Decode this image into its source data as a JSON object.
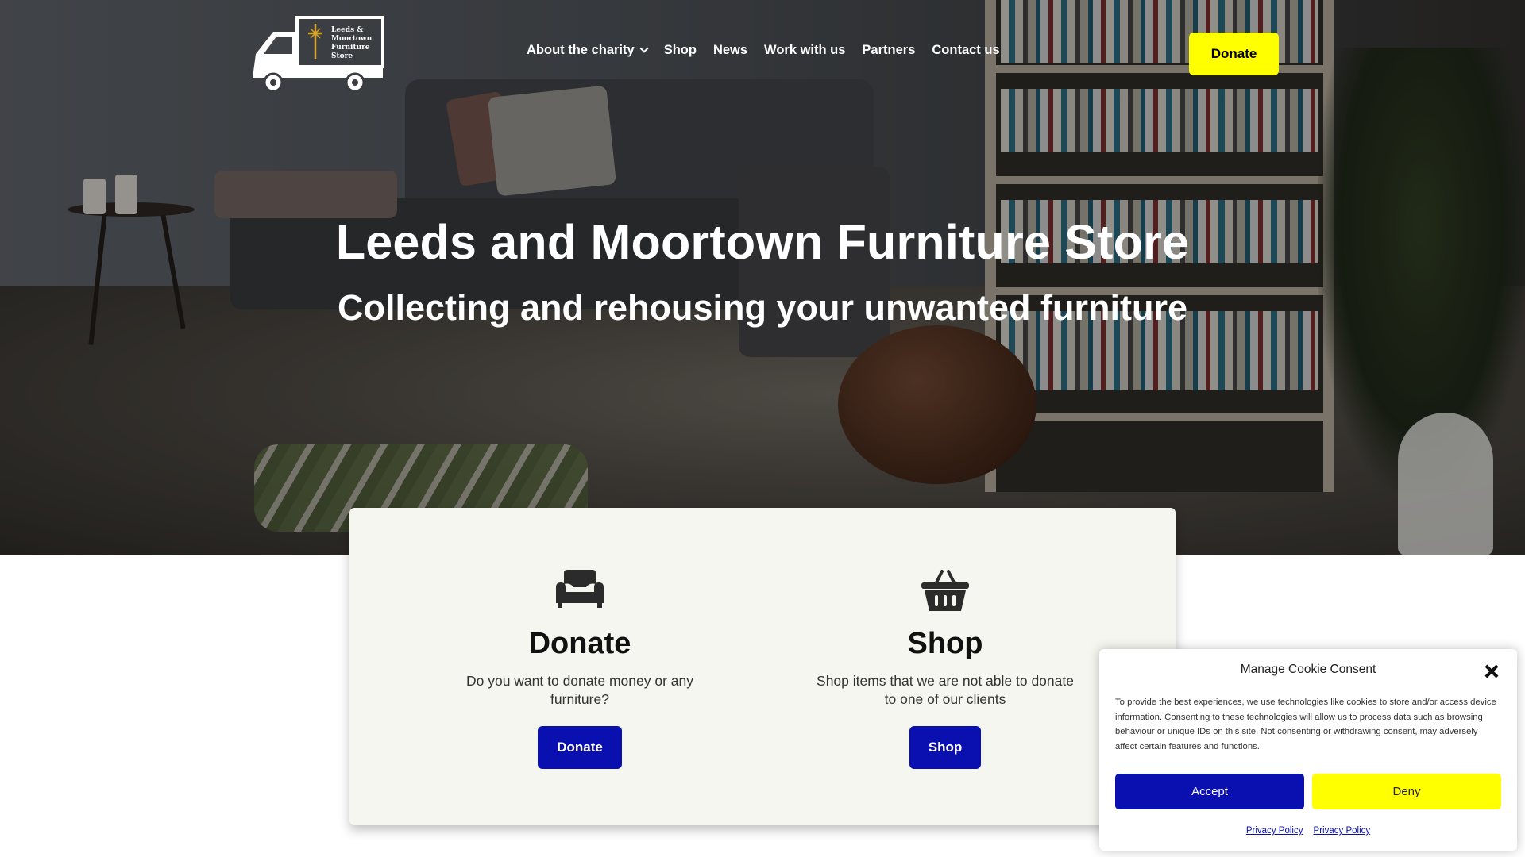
{
  "brand": {
    "logo_lines": [
      "Leeds &",
      "Moortown",
      "Furniture",
      "Store"
    ]
  },
  "nav": {
    "items": [
      {
        "label": "About the charity",
        "has_dropdown": true
      },
      {
        "label": "Shop"
      },
      {
        "label": "News"
      },
      {
        "label": "Work with us"
      },
      {
        "label": "Partners"
      },
      {
        "label": "Contact us"
      }
    ],
    "donate_label": "Donate"
  },
  "hero": {
    "title": "Leeds and Moortown Furniture Store",
    "subtitle": "Collecting and rehousing your unwanted furniture"
  },
  "cards": [
    {
      "icon": "couch-icon",
      "heading": "Donate",
      "text": "Do you want to donate money or any furniture?",
      "button": "Donate"
    },
    {
      "icon": "basket-icon",
      "heading": "Shop",
      "text": "Shop items that we are not able to donate to one of our clients",
      "button": "Shop"
    }
  ],
  "cookie": {
    "title": "Manage Cookie Consent",
    "text": "To provide the best experiences, we use technologies like cookies to store and/or access device information. Consenting to these technologies will allow us to process data such as browsing behaviour or unique IDs on this site. Not consenting or withdrawing consent, may adversely affect certain features and functions.",
    "accept": "Accept",
    "deny": "Deny",
    "links": [
      "Privacy Policy",
      "Privacy Policy"
    ]
  },
  "colors": {
    "primary_blue": "#0a0fb0",
    "accent_yellow": "#ffff00",
    "card_bg": "#f6f6f0"
  }
}
